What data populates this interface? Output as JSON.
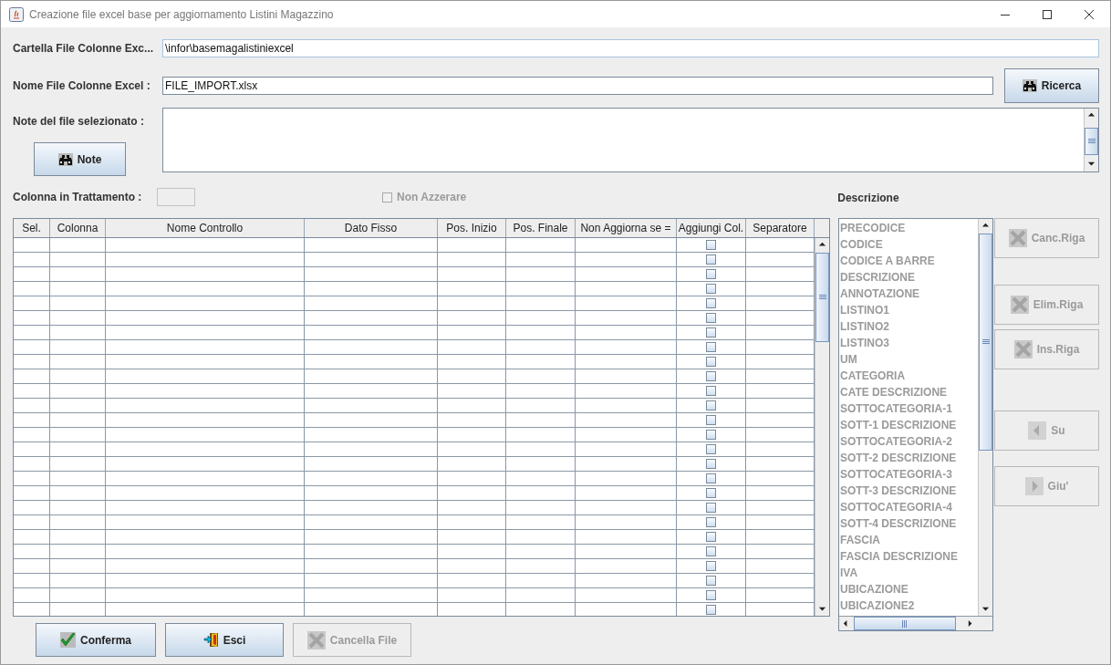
{
  "window": {
    "title": "Creazione file excel base per aggiornamento Listini Magazzino"
  },
  "folder_field": {
    "label": "Cartella File Colonne Exc...",
    "value": "\\infor\\basemagalistiniexcel"
  },
  "file_name_field": {
    "label": "Nome File Colonne Excel :",
    "value": "FILE_IMPORT.xlsx"
  },
  "search_button": {
    "label": "Ricerca",
    "kind": "binoculars",
    "disabled": false
  },
  "notes": {
    "label": "Note del file selezionato :",
    "button": {
      "label": "Note",
      "kind": "binoculars",
      "disabled": false
    }
  },
  "column_in_progress": {
    "label": "Colonna in Trattamento :"
  },
  "non_azzerare": {
    "label": "Non Azzerare",
    "checked": false,
    "disabled": true
  },
  "description": {
    "label": "Descrizione",
    "disabled": true,
    "items": [
      "PRECODICE",
      "CODICE",
      "CODICE A BARRE",
      "DESCRIZIONE",
      "ANNOTAZIONE",
      "LISTINO1",
      "LISTINO2",
      "LISTINO3",
      "UM",
      "CATEGORIA",
      "CATE DESCRIZIONE",
      "SOTTOCATEGORIA-1",
      "SOTT-1 DESCRIZIONE",
      "SOTTOCATEGORIA-2",
      "SOTT-2 DESCRIZIONE",
      "SOTTOCATEGORIA-3",
      "SOTT-3 DESCRIZIONE",
      "SOTTOCATEGORIA-4",
      "SOTT-4 DESCRIZIONE",
      "FASCIA",
      "FASCIA DESCRIZIONE",
      "IVA",
      "UBICAZIONE",
      "UBICAZIONE2"
    ]
  },
  "table": {
    "columns": [
      "Sel.",
      "Colonna",
      "Nome Controllo",
      "Dato Fisso",
      "Pos. Inizio",
      "Pos. Finale",
      "Non Aggiorna se =",
      "Aggiungi Col.",
      "Separatore"
    ],
    "rows": [
      {
        "aggiungi_col": false
      },
      {
        "aggiungi_col": false
      },
      {
        "aggiungi_col": false
      },
      {
        "aggiungi_col": false
      },
      {
        "aggiungi_col": false
      },
      {
        "aggiungi_col": false
      },
      {
        "aggiungi_col": false
      },
      {
        "aggiungi_col": false
      },
      {
        "aggiungi_col": false
      },
      {
        "aggiungi_col": false
      },
      {
        "aggiungi_col": false
      },
      {
        "aggiungi_col": false
      },
      {
        "aggiungi_col": false
      },
      {
        "aggiungi_col": false
      },
      {
        "aggiungi_col": false
      },
      {
        "aggiungi_col": false
      },
      {
        "aggiungi_col": false
      },
      {
        "aggiungi_col": false
      },
      {
        "aggiungi_col": false
      },
      {
        "aggiungi_col": false
      },
      {
        "aggiungi_col": false
      },
      {
        "aggiungi_col": false
      },
      {
        "aggiungi_col": false
      },
      {
        "aggiungi_col": false
      },
      {
        "aggiungi_col": false
      },
      {
        "aggiungi_col": false
      }
    ]
  },
  "side_buttons": [
    {
      "label": "Canc.Riga",
      "kind": "cross",
      "disabled": true
    },
    {
      "label": "Elim.Riga",
      "kind": "cross",
      "disabled": true
    },
    {
      "label": "Ins.Riga",
      "kind": "cross",
      "disabled": true
    },
    {
      "label": "Su",
      "kind": "left",
      "disabled": true
    },
    {
      "label": "Giu'",
      "kind": "right",
      "disabled": true
    }
  ],
  "bottom_buttons": [
    {
      "label": "Conferma",
      "kind": "check",
      "disabled": false
    },
    {
      "label": "Esci",
      "kind": "exit",
      "disabled": false
    },
    {
      "label": "Cancella File",
      "kind": "cross",
      "disabled": true
    }
  ]
}
